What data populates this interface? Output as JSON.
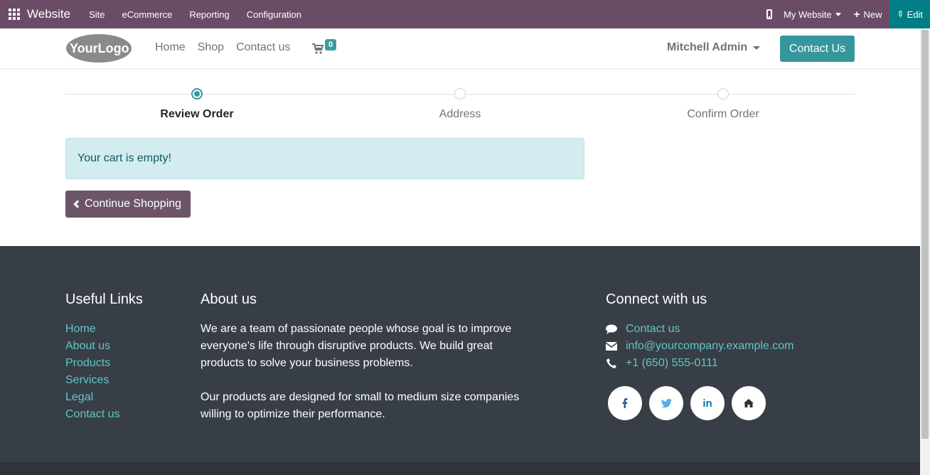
{
  "admin_bar": {
    "brand": "Website",
    "menu": [
      "Site",
      "eCommerce",
      "Reporting",
      "Configuration"
    ],
    "website_selector": "My Website",
    "new_label": "New",
    "edit_label": "Edit"
  },
  "header": {
    "logo_text": "YourLogo",
    "nav": [
      "Home",
      "Shop",
      "Contact us"
    ],
    "cart_count": "0",
    "user_name": "Mitchell Admin",
    "contact_button": "Contact Us"
  },
  "wizard": {
    "steps": [
      "Review Order",
      "Address",
      "Confirm Order"
    ],
    "active_step": 0
  },
  "cart": {
    "empty_message": "Your cart is empty!",
    "continue_label": "Continue Shopping"
  },
  "footer": {
    "useful_links_title": "Useful Links",
    "useful_links": [
      "Home",
      "About us",
      "Products",
      "Services",
      "Legal",
      "Contact us"
    ],
    "about_title": "About us",
    "about_p1": "We are a team of passionate people whose goal is to improve everyone's life through disruptive products. We build great products to solve your business problems.",
    "about_p2": "Our products are designed for small to medium size companies willing to optimize their performance.",
    "connect_title": "Connect with us",
    "contact_link": "Contact us",
    "email": "info@yourcompany.example.com",
    "phone": "+1 (650) 555-0111",
    "social_icons": [
      "facebook-icon",
      "twitter-icon",
      "linkedin-icon",
      "home-icon"
    ]
  },
  "colors": {
    "admin_bar": "#6b4c66",
    "accent": "#35979c",
    "footer_bg": "#383e45",
    "footer_link": "#5fc7c8"
  }
}
